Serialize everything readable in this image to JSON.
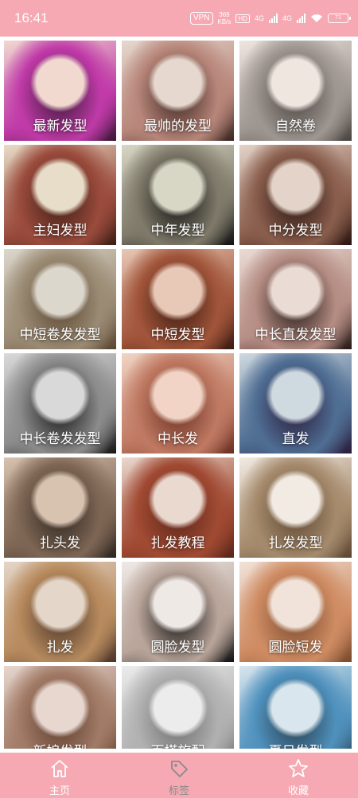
{
  "status_bar": {
    "time": "16:41",
    "vpn": "VPN",
    "speed_value": "369",
    "speed_unit": "KB/s",
    "hd": "HD",
    "net1": "4G",
    "net2": "4G",
    "battery": "71"
  },
  "categories": [
    {
      "label": "最新发型",
      "colors": [
        "#f1d9d0",
        "#c03aa8",
        "#3a1836"
      ]
    },
    {
      "label": "最帅的发型",
      "colors": [
        "#e6d8cf",
        "#b8867a",
        "#3b2620"
      ]
    },
    {
      "label": "自然卷",
      "colors": [
        "#efe6e0",
        "#9e9690",
        "#4a4441"
      ]
    },
    {
      "label": "主妇发型",
      "colors": [
        "#e8ddc8",
        "#9a4b3c",
        "#3e1e16"
      ]
    },
    {
      "label": "中年发型",
      "colors": [
        "#d8d7c6",
        "#7f7a6a",
        "#111111"
      ]
    },
    {
      "label": "中分发型",
      "colors": [
        "#e3d3c8",
        "#8a5e4d",
        "#2a1510"
      ]
    },
    {
      "label": "中短卷发发型",
      "colors": [
        "#dcd7cc",
        "#9b8b74",
        "#5a4632"
      ]
    },
    {
      "label": "中短发型",
      "colors": [
        "#e8c8b6",
        "#a1553a",
        "#3b1a10"
      ]
    },
    {
      "label": "中长直发发型",
      "colors": [
        "#eadbd4",
        "#b58d84",
        "#251815"
      ]
    },
    {
      "label": "中长卷发发型",
      "colors": [
        "#d9d9d9",
        "#8c8c8c",
        "#151515"
      ]
    },
    {
      "label": "中长发",
      "colors": [
        "#f1d4c5",
        "#c07a63",
        "#6a2f22"
      ]
    },
    {
      "label": "直发",
      "colors": [
        "#cfd9e0",
        "#4f6e93",
        "#2a1b3a"
      ]
    },
    {
      "label": "扎头发",
      "colors": [
        "#d8c2b0",
        "#7e6654",
        "#2d2520"
      ]
    },
    {
      "label": "扎发教程",
      "colors": [
        "#ead9cf",
        "#a14a33",
        "#5a2518"
      ]
    },
    {
      "label": "扎发发型",
      "colors": [
        "#f2ebe3",
        "#a58a6c",
        "#5c4530"
      ]
    },
    {
      "label": "扎发",
      "colors": [
        "#e4d6c8",
        "#b88b5e",
        "#4b3428"
      ]
    },
    {
      "label": "圆脸发型",
      "colors": [
        "#efe9e6",
        "#b9a59a",
        "#111111"
      ]
    },
    {
      "label": "圆脸短发",
      "colors": [
        "#f1e3d9",
        "#cf8c63",
        "#7a4a2c"
      ]
    },
    {
      "label": "新娘发型",
      "colors": [
        "#e7d7cf",
        "#a27b67",
        "#5d3d2e"
      ]
    },
    {
      "label": "百搭旅配",
      "colors": [
        "#ececec",
        "#b1b1b1",
        "#6d6d6d"
      ]
    },
    {
      "label": "夏日发型",
      "colors": [
        "#d9e6ee",
        "#4f91bd",
        "#283c4c"
      ]
    }
  ],
  "tabs": [
    {
      "label": "主页",
      "icon": "home-icon",
      "active": false
    },
    {
      "label": "标签",
      "icon": "tag-icon",
      "active": true
    },
    {
      "label": "收藏",
      "icon": "star-icon",
      "active": false
    }
  ],
  "colors": {
    "accent": "#f6a9b3",
    "label_text": "#ffffff"
  }
}
